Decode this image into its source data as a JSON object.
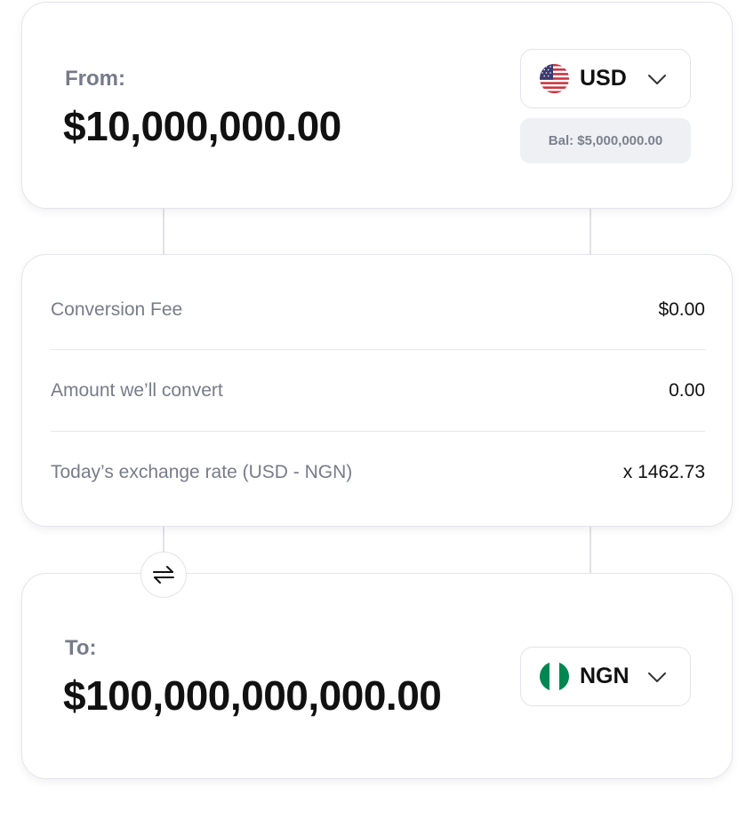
{
  "from": {
    "label": "From:",
    "amount": "$10,000,000.00",
    "currency": {
      "code": "USD",
      "flag_icon": "us-flag-icon"
    },
    "balance": "Bal: $5,000,000.00"
  },
  "details": {
    "rows": [
      {
        "label": "Conversion Fee",
        "value": "$0.00"
      },
      {
        "label": "Amount we’ll convert",
        "value": "0.00"
      },
      {
        "label": "Today’s exchange rate (USD - NGN)",
        "value": "x 1462.73"
      }
    ]
  },
  "swap": {
    "icon": "swap-arrows-icon"
  },
  "to": {
    "label": "To:",
    "amount": "$100,000,000,000.00",
    "currency": {
      "code": "NGN",
      "flag_icon": "ng-flag-icon"
    }
  },
  "colors": {
    "label_gray": "#757b88",
    "amount_text": "#111111",
    "border": "#e4e4ec",
    "balance_bg": "#eef0f4",
    "nigeria_green": "#008751",
    "us_red": "#c8313e",
    "us_blue": "#3c3b6e"
  }
}
